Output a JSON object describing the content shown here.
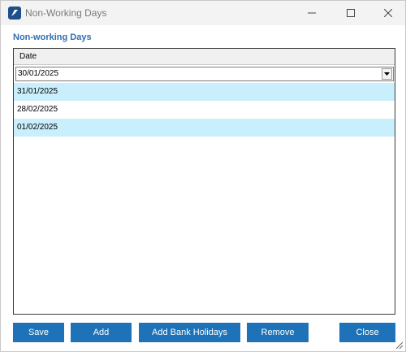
{
  "window": {
    "title": "Non-Working Days"
  },
  "section_label": "Non-working Days",
  "grid": {
    "column_header": "Date",
    "editing_value": "30/01/2025",
    "rows": [
      "31/01/2025",
      "28/02/2025",
      "01/02/2025"
    ]
  },
  "buttons": {
    "save": "Save",
    "add": "Add",
    "add_bank_holidays": "Add Bank Holidays",
    "remove": "Remove",
    "close": "Close"
  },
  "colors": {
    "accent": "#1d72b8",
    "row_highlight": "#c9eefc",
    "label": "#2c6fb5"
  }
}
